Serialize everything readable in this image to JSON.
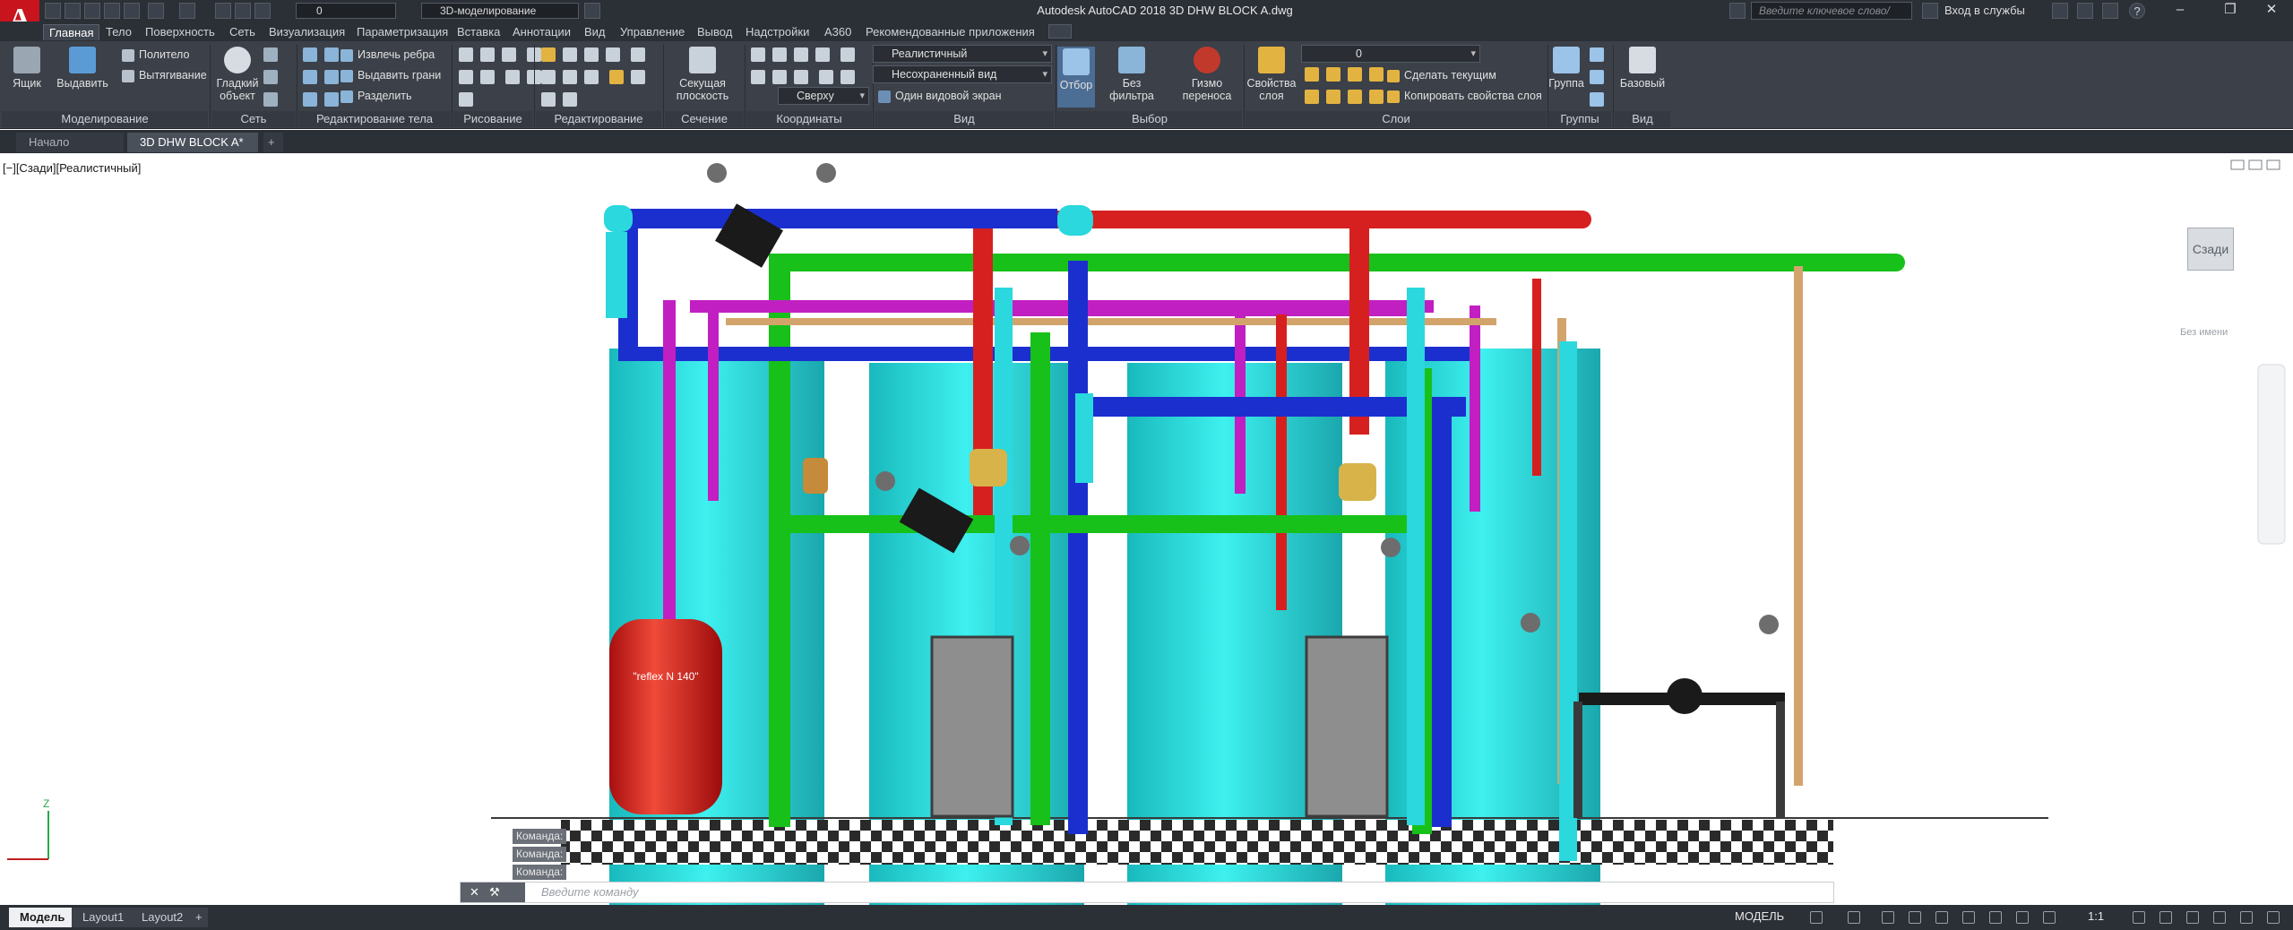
{
  "titlebar": {
    "app_letter": "A",
    "workspace": "3D-моделирование",
    "layer": "0",
    "window_title": "Autodesk AutoCAD 2018    3D DHW BLOCK A.dwg",
    "search_placeholder": "Введите ключевое слово/фразу",
    "login": "Вход в службы",
    "help": "?",
    "minimize": "–",
    "restore": "❐",
    "close": "✕"
  },
  "menu": {
    "tabs": [
      "Главная",
      "Тело",
      "Поверхность",
      "Сеть",
      "Визуализация",
      "Параметризация",
      "Вставка",
      "Аннотации",
      "Вид",
      "Управление",
      "Вывод",
      "Надстройки",
      "A360",
      "Рекомендованные приложения"
    ]
  },
  "ribbon": {
    "modeling": {
      "box": "Ящик",
      "extrude": "Выдавить",
      "polysolid": "Политело",
      "presspull": "Вытягивание",
      "title": "Моделирование"
    },
    "mesh": {
      "smooth": "Гладкий объект",
      "title": "Сеть"
    },
    "solid_edit": {
      "extract_edges": "Извлечь ребра",
      "extrude_faces": "Выдавить грани",
      "separate": "Разделить",
      "title": "Редактирование тела"
    },
    "draw": {
      "title": "Рисование"
    },
    "modify": {
      "title": "Редактирование"
    },
    "section": {
      "plane": "Секущая плоскость",
      "title": "Сечение"
    },
    "coordinates": {
      "title": "Координаты"
    },
    "view": {
      "visual_style": "Реалистичный",
      "named_view": "Несохраненный вид",
      "direction": "Сверху",
      "viewport": "Один видовой экран",
      "title": "Вид"
    },
    "selection": {
      "culling": "Отбор",
      "no_filter": "Без фильтра",
      "gizmo": "Гизмо переноса",
      "title": "Выбор"
    },
    "layers": {
      "properties": "Свойства слоя",
      "current_layer": "0",
      "make_current": "Сделать текущим",
      "match_layer": "Копировать свойства слоя",
      "title": "Слои"
    },
    "groups": {
      "group": "Группа",
      "title": "Группы"
    },
    "view2": {
      "base": "Базовый",
      "title": "Вид"
    }
  },
  "doctabs": {
    "start": "Начало",
    "drawing": "3D DHW BLOCK A*",
    "add": "+"
  },
  "viewport": {
    "label": "[−][Сзади][Реалистичный]",
    "viewcube_face": "Сзади",
    "ucs_name": "Без имени",
    "vessel_label": "\"reflex N 140\"",
    "axis_z": "Z"
  },
  "command": {
    "history": [
      "Команда:",
      "Команда:",
      "Команда:"
    ],
    "placeholder": "Введите команду"
  },
  "statusbar": {
    "layouts": [
      "Модель",
      "Layout1",
      "Layout2"
    ],
    "add": "+",
    "mode": "МОДЕЛЬ",
    "scale": "1:1"
  },
  "colors": {
    "pipe_red": "#d62020",
    "pipe_blue": "#1b2fcf",
    "pipe_green": "#18c01a",
    "pipe_magenta": "#c11fc1",
    "pipe_tan": "#d2a46c",
    "tank_cyan": "#22d4d4",
    "vessel_red": "#d41a1a"
  }
}
